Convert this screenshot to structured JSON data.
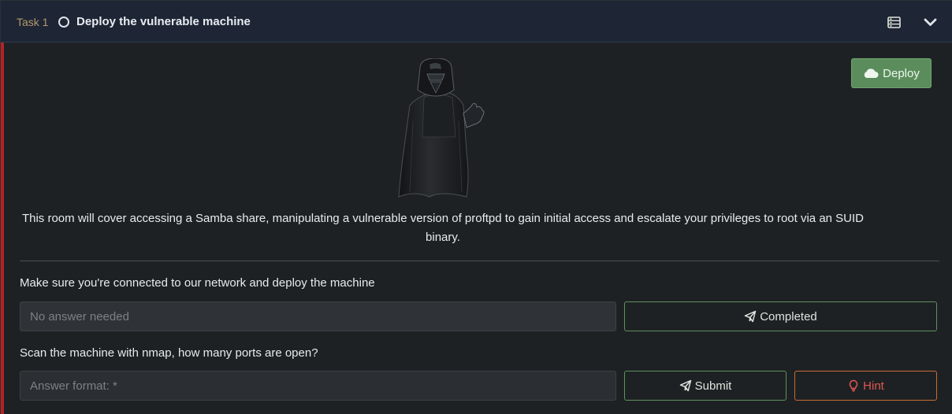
{
  "task": {
    "label": "Task 1",
    "title": "Deploy the vulnerable machine",
    "status_icon": "circle-outline-icon",
    "header_icons": [
      "server-icon",
      "chevron-down-icon"
    ]
  },
  "deploy_button": {
    "label": "Deploy",
    "icon": "cloud-icon"
  },
  "illustration": {
    "icon": "darth-vader-icon"
  },
  "intro": {
    "text": "This room will cover accessing a Samba share, manipulating a vulnerable version of proftpd to gain initial access and escalate your privileges to root via an SUID binary."
  },
  "questions": [
    {
      "text": "Make sure you're connected to our network and deploy the machine",
      "placeholder": "No answer needed",
      "button_label": "Completed",
      "button_icon": "paper-plane-icon"
    },
    {
      "text": "Scan the machine with nmap, how many ports are open?",
      "placeholder": "Answer format: *",
      "button_label": "Submit",
      "button_icon": "paper-plane-icon",
      "hint_label": "Hint",
      "hint_icon": "lightbulb-icon"
    }
  ],
  "colors": {
    "accent_red": "#b32226",
    "task_label": "#b39b6a",
    "deploy_green": "#5b8d5c",
    "success_border": "#5f915f",
    "hint_border": "#c46d32",
    "hint_text": "#e05750"
  }
}
